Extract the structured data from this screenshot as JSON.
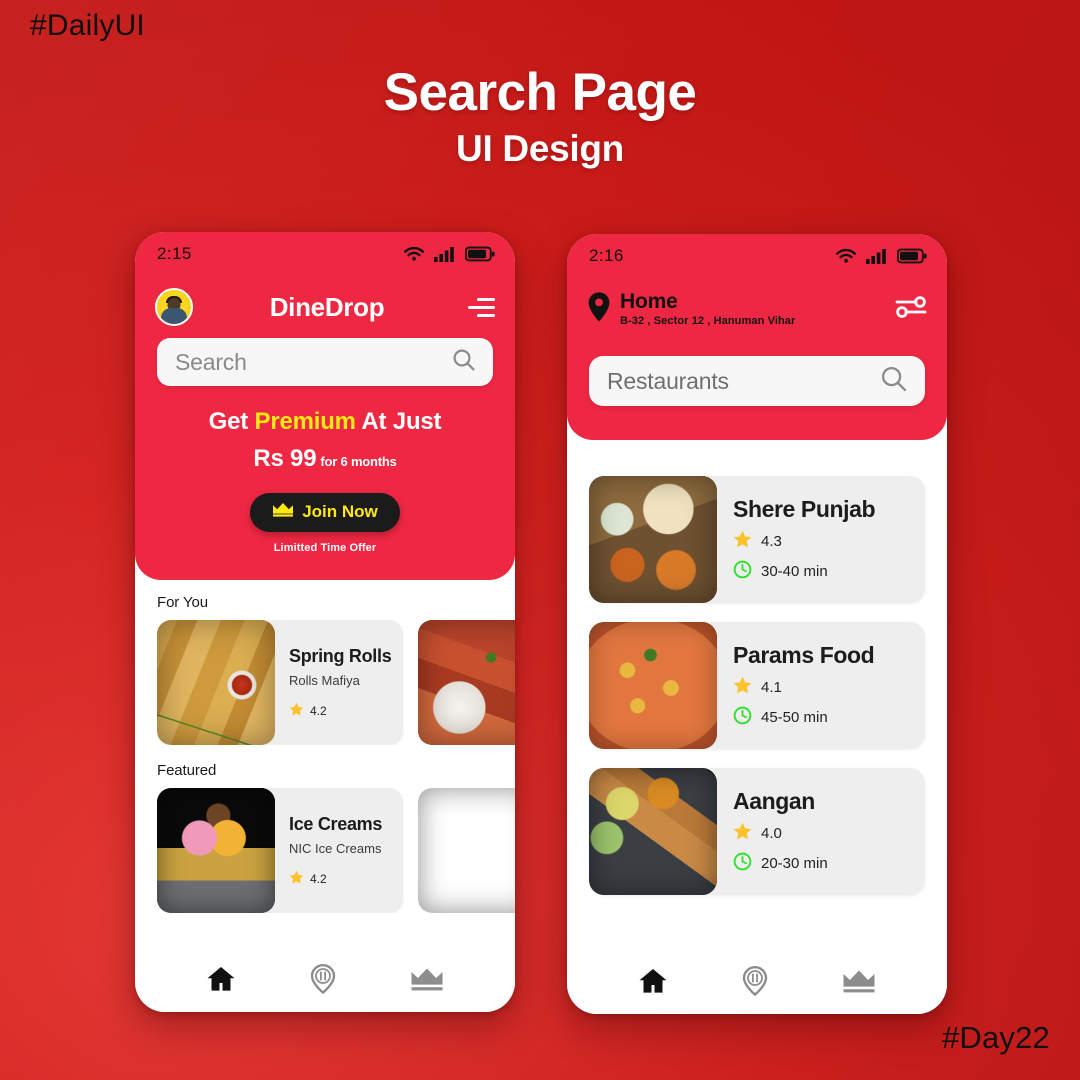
{
  "poster": {
    "tag_top": "#DailyUI",
    "title": "Search Page",
    "subtitle": "UI Design",
    "tag_bottom": "#Day22",
    "background_color": "#cc201c",
    "accent_color": "#ee2742"
  },
  "screen_home": {
    "statusbar": {
      "time": "2:15",
      "wifi_icon": "wifi-icon",
      "signal_icon": "signal-bars-icon",
      "battery_icon": "battery-icon"
    },
    "appbar": {
      "avatar": "user-avatar",
      "title": "DineDrop",
      "menu_icon": "hamburger-menu-icon"
    },
    "search": {
      "placeholder": "Search",
      "value": "",
      "icon": "search-icon"
    },
    "promo": {
      "line1_before": "Get ",
      "line1_highlight": "Premium",
      "line1_after": " At Just",
      "price": "Rs 99",
      "price_note": "for 6 months",
      "button_label": "Join Now",
      "button_icon": "crown-icon",
      "note": "Limitted Time Offer",
      "highlight_color": "#ffe814"
    },
    "sections": [
      {
        "label": "For You",
        "cards": [
          {
            "name": "Spring Rolls",
            "desc": "Rolls Mafiya",
            "rating": "4.2",
            "rating_icon": "star-icon",
            "image": "spring-rolls-photo"
          },
          {
            "name": "",
            "desc": "",
            "rating": "",
            "rating_icon": "star-icon",
            "image": "pasta-photo"
          }
        ]
      },
      {
        "label": "Featured",
        "cards": [
          {
            "name": "Ice Creams",
            "desc": "NIC Ice Creams",
            "rating": "4.2",
            "rating_icon": "star-icon",
            "image": "ice-cream-photo"
          },
          {
            "name": "",
            "desc": "",
            "rating": "",
            "rating_icon": "star-icon",
            "image": "burger-photo"
          }
        ]
      }
    ],
    "bottomnav": [
      {
        "icon": "home-icon",
        "active": true
      },
      {
        "icon": "restaurant-pin-icon",
        "active": false
      },
      {
        "icon": "crown-icon",
        "active": false
      }
    ]
  },
  "screen_search": {
    "statusbar": {
      "time": "2:16",
      "wifi_icon": "wifi-icon",
      "signal_icon": "signal-bars-icon",
      "battery_icon": "battery-icon"
    },
    "location": {
      "pin_icon": "location-pin-icon",
      "label": "Home",
      "address": "B-32 , Sector 12 , Hanuman Vihar",
      "filter_icon": "filter-sliders-icon"
    },
    "search": {
      "placeholder": "Restaurants",
      "value": "Restaurants",
      "icon": "search-icon"
    },
    "results": [
      {
        "name": "Shere Punjab",
        "rating": "4.3",
        "time": "30-40 min",
        "star_icon": "star-icon",
        "clock_icon": "clock-icon",
        "image": "thali-photo"
      },
      {
        "name": "Params Food",
        "rating": "4.1",
        "time": "45-50 min",
        "star_icon": "star-icon",
        "clock_icon": "clock-icon",
        "image": "paneer-curry-photo"
      },
      {
        "name": "Aangan",
        "rating": "4.0",
        "time": "20-30 min",
        "star_icon": "star-icon",
        "clock_icon": "clock-icon",
        "image": "dosa-photo"
      }
    ],
    "bottomnav": [
      {
        "icon": "home-icon",
        "active": true
      },
      {
        "icon": "restaurant-pin-icon",
        "active": false
      },
      {
        "icon": "crown-icon",
        "active": false
      }
    ]
  }
}
